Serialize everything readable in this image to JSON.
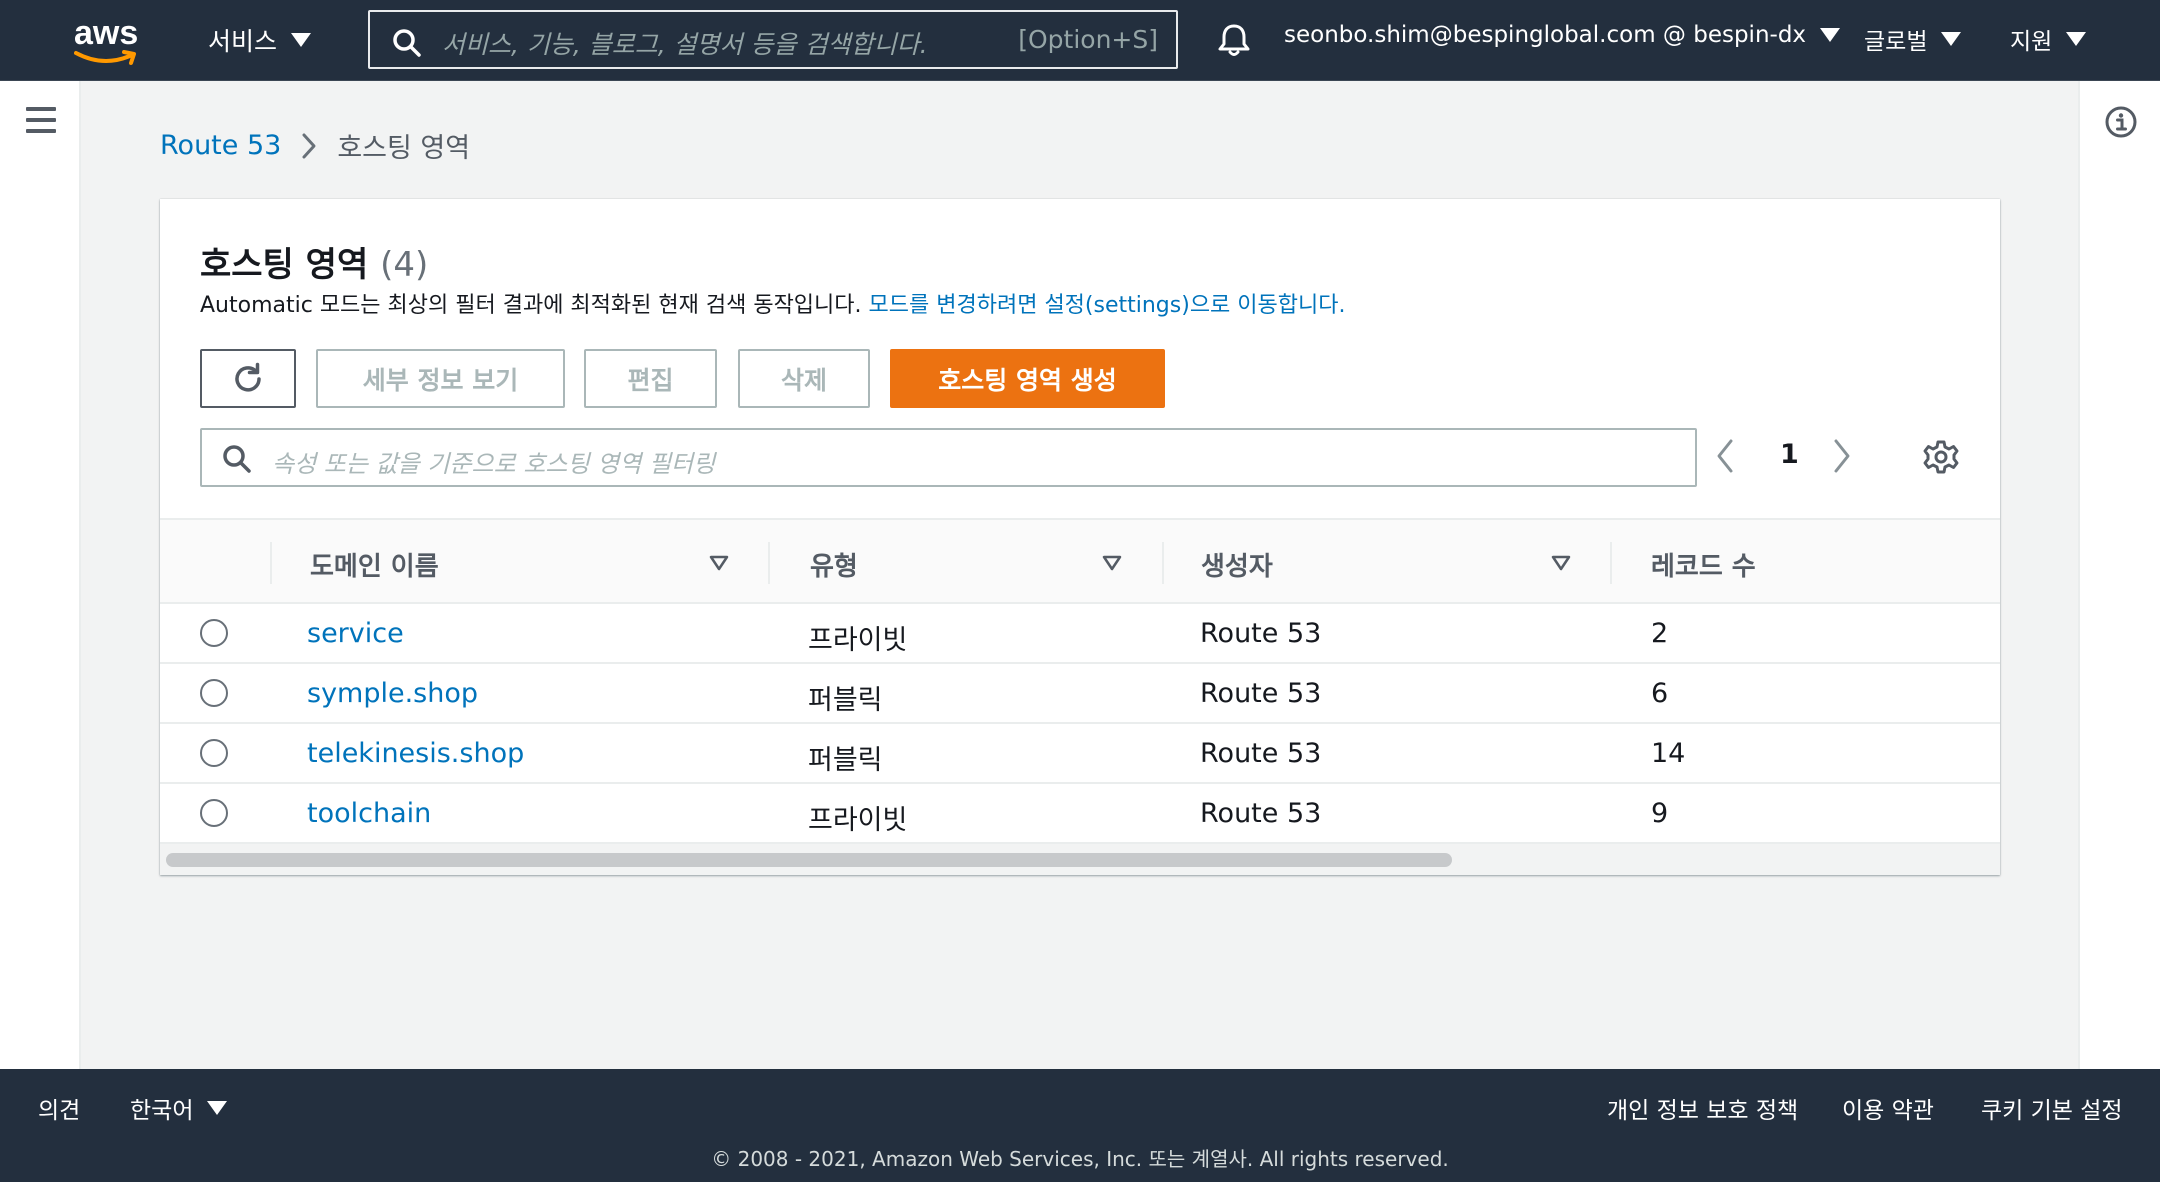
{
  "topnav": {
    "logo_text": "aws",
    "services_label": "서비스",
    "search_placeholder": "서비스, 기능, 블로그, 설명서 등을 검색합니다.",
    "search_shortcut": "[Option+S]",
    "account_label": "seonbo.shim@bespinglobal.com @ bespin-dx",
    "region_label": "글로벌",
    "support_label": "지원"
  },
  "breadcrumb": {
    "parent": "Route 53",
    "current": "호스팅 영역"
  },
  "panel": {
    "title": "호스팅 영역",
    "count": "(4)",
    "description": "Automatic 모드는 최상의 필터 결과에 최적화된 현재 검색 동작입니다.",
    "description_link": "모드를 변경하려면 설정(settings)으로 이동합니다.",
    "buttons": {
      "details": "세부 정보 보기",
      "edit": "편집",
      "delete": "삭제",
      "create": "호스팅 영역 생성"
    },
    "filter_placeholder": "속성 또는 값을 기준으로 호스팅 영역 필터링",
    "page_number": "1"
  },
  "table": {
    "columns": [
      "도메인 이름",
      "유형",
      "생성자",
      "레코드 수"
    ],
    "rows": [
      {
        "domain": "service",
        "type": "프라이빗",
        "created_by": "Route 53",
        "records": "2"
      },
      {
        "domain": "symple.shop",
        "type": "퍼블릭",
        "created_by": "Route 53",
        "records": "6"
      },
      {
        "domain": "telekinesis.shop",
        "type": "퍼블릭",
        "created_by": "Route 53",
        "records": "14"
      },
      {
        "domain": "toolchain",
        "type": "프라이빗",
        "created_by": "Route 53",
        "records": "9"
      }
    ]
  },
  "footer": {
    "feedback": "의견",
    "language": "한국어",
    "privacy": "개인 정보 보호 정책",
    "terms": "이용 약관",
    "cookies": "쿠키 기본 설정",
    "copyright": "© 2008 - 2021, Amazon Web Services, Inc. 또는 계열사. All rights reserved."
  },
  "colors": {
    "nav_bg": "#232f3e",
    "accent_orange": "#ec7211",
    "link_blue": "#0073bb",
    "disabled_gray": "#aab7b8"
  },
  "icons": [
    "aws-smile-icon",
    "caret-down-icon",
    "search-icon",
    "bell-icon",
    "hamburger-icon",
    "info-icon",
    "chevron-right-icon",
    "refresh-icon",
    "chevron-left-icon",
    "gear-icon",
    "sort-triangle-icon"
  ]
}
